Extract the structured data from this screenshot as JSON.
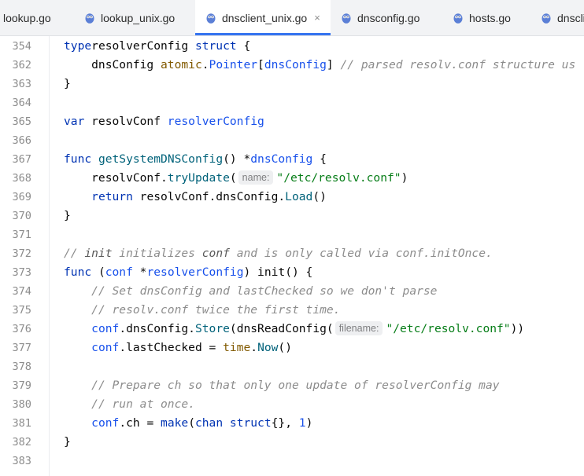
{
  "editor": {
    "tabs": [
      {
        "label": "lookup.go",
        "active": false,
        "icon": "gopher-icon"
      },
      {
        "label": "lookup_unix.go",
        "active": false,
        "icon": "gopher-icon"
      },
      {
        "label": "dnsclient_unix.go",
        "active": true,
        "icon": "gopher-icon",
        "close": "×"
      },
      {
        "label": "dnsconfig.go",
        "active": false,
        "icon": "gopher-icon"
      },
      {
        "label": "hosts.go",
        "active": false,
        "icon": "gopher-icon"
      },
      {
        "label": "dnscli",
        "active": false,
        "icon": "gopher-icon"
      }
    ],
    "lines": [
      {
        "n": "354",
        "tokens": [
          [
            "kw",
            "type"
          ],
          [
            "",
            "resolverConfig "
          ],
          [
            "kw",
            "struct"
          ],
          [
            "",
            " {"
          ]
        ]
      },
      {
        "n": "362",
        "tokens": [
          [
            "",
            "    dnsConfig "
          ],
          [
            "pkg",
            "atomic"
          ],
          [
            "",
            "."
          ],
          [
            "ty",
            "Pointer"
          ],
          [
            "",
            "["
          ],
          [
            "ty",
            "dnsConfig"
          ],
          [
            "",
            "] "
          ],
          [
            "cm",
            "// parsed resolv.conf structure us"
          ]
        ]
      },
      {
        "n": "363",
        "tokens": [
          [
            "",
            "}"
          ]
        ]
      },
      {
        "n": "364",
        "tokens": []
      },
      {
        "n": "365",
        "tokens": [
          [
            "kw",
            "var"
          ],
          [
            "",
            " resolvConf "
          ],
          [
            "ty",
            "resolverConfig"
          ]
        ]
      },
      {
        "n": "366",
        "tokens": []
      },
      {
        "n": "367",
        "tokens": [
          [
            "kw",
            "func"
          ],
          [
            "",
            " "
          ],
          [
            "fn",
            "getSystemDNSConfig"
          ],
          [
            "",
            "() *"
          ],
          [
            "ty",
            "dnsConfig"
          ],
          [
            "",
            " {"
          ]
        ]
      },
      {
        "n": "368",
        "tokens": [
          [
            "",
            "    resolvConf."
          ],
          [
            "fn",
            "tryUpdate"
          ],
          [
            "",
            "("
          ],
          [
            "hint",
            "name:"
          ],
          [
            "str",
            "\"/etc/resolv.conf\""
          ],
          [
            "",
            ")"
          ]
        ]
      },
      {
        "n": "369",
        "tokens": [
          [
            "",
            "    "
          ],
          [
            "kw",
            "return"
          ],
          [
            "",
            " resolvConf.dnsConfig."
          ],
          [
            "fn",
            "Load"
          ],
          [
            "",
            "()"
          ]
        ]
      },
      {
        "n": "370",
        "tokens": [
          [
            "",
            "}"
          ]
        ]
      },
      {
        "n": "371",
        "tokens": []
      },
      {
        "n": "372",
        "tokens": [
          [
            "cm",
            "// "
          ],
          [
            "cmk",
            "init"
          ],
          [
            "cm",
            " initializes "
          ],
          [
            "cmk",
            "conf"
          ],
          [
            "cm",
            " and is only called via conf.initOnce."
          ]
        ]
      },
      {
        "n": "373",
        "tokens": [
          [
            "kw",
            "func"
          ],
          [
            "",
            " ("
          ],
          [
            "ty",
            "conf"
          ],
          [
            "",
            " *"
          ],
          [
            "ty",
            "resolverConfig"
          ],
          [
            "",
            ") init() {"
          ]
        ]
      },
      {
        "n": "374",
        "tokens": [
          [
            "",
            "    "
          ],
          [
            "cm",
            "// Set dnsConfig and lastChecked so we don't parse"
          ]
        ]
      },
      {
        "n": "375",
        "tokens": [
          [
            "",
            "    "
          ],
          [
            "cm",
            "// resolv.conf twice the first time."
          ]
        ]
      },
      {
        "n": "376",
        "tokens": [
          [
            "",
            "    "
          ],
          [
            "ty",
            "conf"
          ],
          [
            "",
            ".dnsConfig."
          ],
          [
            "fn",
            "Store"
          ],
          [
            "",
            "(dnsReadConfig("
          ],
          [
            "hint",
            "filename:"
          ],
          [
            "str",
            "\"/etc/resolv.conf\""
          ],
          [
            "",
            "))"
          ]
        ]
      },
      {
        "n": "377",
        "tokens": [
          [
            "",
            "    "
          ],
          [
            "ty",
            "conf"
          ],
          [
            "",
            ".lastChecked = "
          ],
          [
            "pkg",
            "time"
          ],
          [
            "",
            "."
          ],
          [
            "fn",
            "Now"
          ],
          [
            "",
            "()"
          ]
        ]
      },
      {
        "n": "378",
        "tokens": []
      },
      {
        "n": "379",
        "tokens": [
          [
            "",
            "    "
          ],
          [
            "cm",
            "// Prepare ch so that only one update of resolverConfig may"
          ]
        ]
      },
      {
        "n": "380",
        "tokens": [
          [
            "",
            "    "
          ],
          [
            "cm",
            "// run at once."
          ]
        ]
      },
      {
        "n": "381",
        "tokens": [
          [
            "",
            "    "
          ],
          [
            "ty",
            "conf"
          ],
          [
            "",
            ".ch = "
          ],
          [
            "kw",
            "make"
          ],
          [
            "",
            "("
          ],
          [
            "kw",
            "chan struct"
          ],
          [
            "",
            "{}, "
          ],
          [
            "num",
            "1"
          ],
          [
            "",
            ")"
          ]
        ]
      },
      {
        "n": "382",
        "tokens": [
          [
            "",
            "}"
          ]
        ]
      },
      {
        "n": "383",
        "tokens": []
      }
    ]
  }
}
